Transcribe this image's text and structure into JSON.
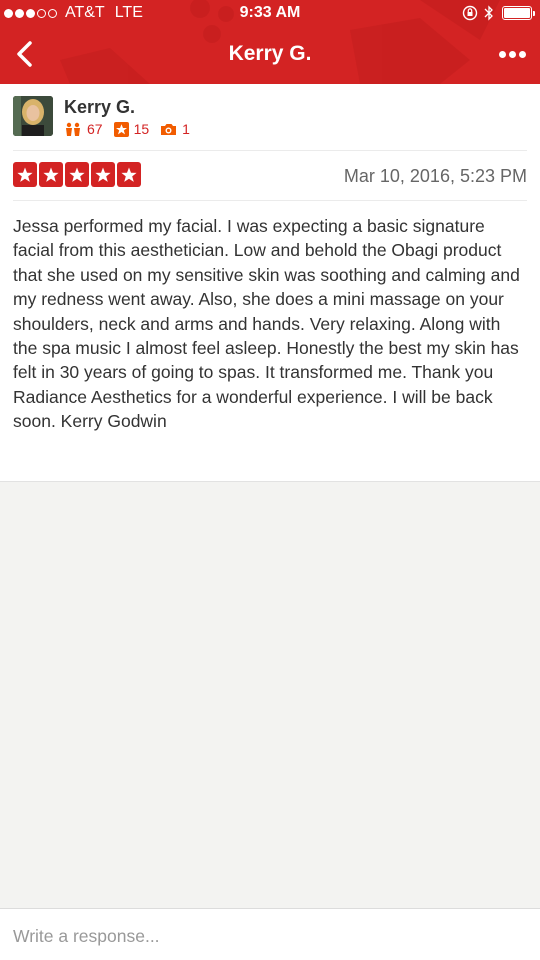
{
  "status_bar": {
    "carrier": "AT&T",
    "network": "LTE",
    "time": "9:33 AM"
  },
  "nav": {
    "title": "Kerry G."
  },
  "reviewer": {
    "name": "Kerry G.",
    "friends_count": "67",
    "reviews_count": "15",
    "photos_count": "1"
  },
  "review": {
    "rating": 5,
    "date": "Mar 10, 2016, 5:23 PM",
    "text": "Jessa performed my facial.  I was expecting a basic signature facial from this aesthetician.  Low and behold the Obagi product that she used on my sensitive skin was soothing and calming and my redness went away.  Also, she does a mini massage on your shoulders, neck and arms and hands.  Very relaxing.  Along with the spa music I almost feel asleep.  Honestly the best my skin has felt in 30 years of going to spas.  It transformed me.  Thank you Radiance Aesthetics for a wonderful experience.  I will be back soon.  Kerry Godwin"
  },
  "response": {
    "placeholder": "Write a response..."
  },
  "colors": {
    "brand_red": "#d32323",
    "text": "#333333",
    "muted": "#666666",
    "background": "#f3f3f1"
  }
}
